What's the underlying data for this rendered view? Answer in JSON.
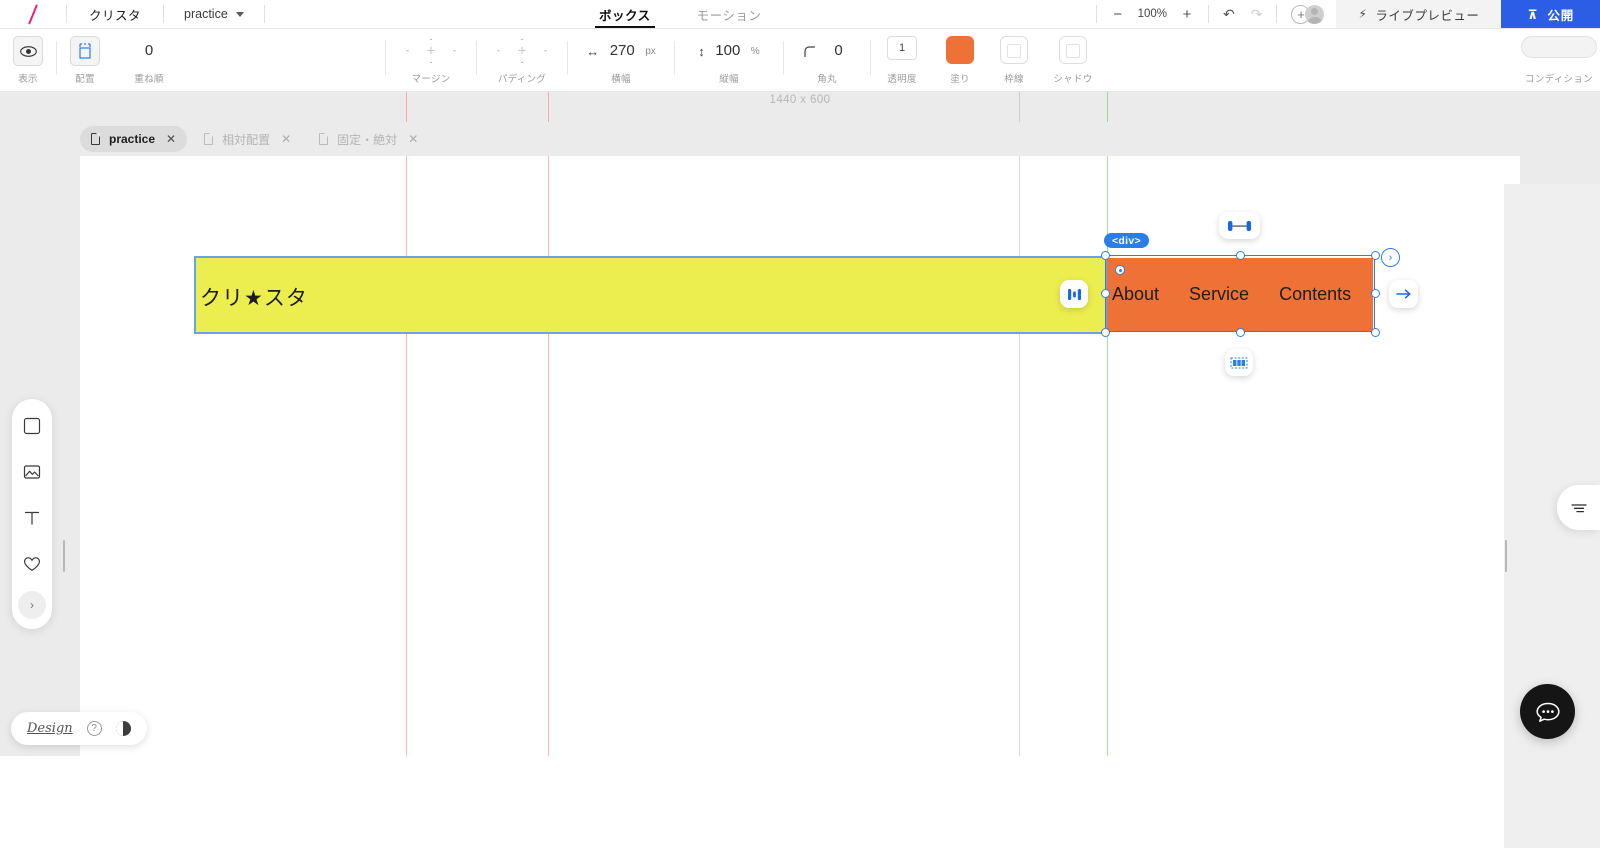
{
  "topbar": {
    "logo": "slash-logo",
    "brand": "クリスタ",
    "project": "practice",
    "tabs": [
      {
        "label": "ボックス",
        "active": true
      },
      {
        "label": "モーション",
        "active": false
      }
    ],
    "zoom": {
      "out": "−",
      "level": "100%",
      "in": "+"
    },
    "undo": "↶",
    "redo": "↷",
    "add": "+",
    "live_preview": "ライブプレビュー",
    "publish": "公開",
    "publish_color": "#2c5de5"
  },
  "properties": {
    "visibility": {
      "label": "表示",
      "icon": "eye-icon"
    },
    "layout": {
      "label": "配置",
      "icon": "layout-icon"
    },
    "zorder": {
      "label": "重ね順",
      "value": "0"
    },
    "margin": {
      "label": "マージン",
      "top": "-",
      "right": "-",
      "bottom": "-",
      "left": "-",
      "center": "+"
    },
    "padding": {
      "label": "パディング",
      "top": "-",
      "right": "-",
      "bottom": "-",
      "left": "-",
      "center": "+"
    },
    "width": {
      "label": "横幅",
      "value": "270",
      "unit": "px",
      "icon": "↔"
    },
    "height": {
      "label": "縦幅",
      "value": "100",
      "unit": "%",
      "icon": "↕"
    },
    "radius": {
      "label": "角丸",
      "value": "0",
      "icon": "⌐"
    },
    "opacity": {
      "label": "透明度",
      "value": "1"
    },
    "fill": {
      "label": "塗り",
      "color": "#ee7136"
    },
    "border": {
      "label": "枠線",
      "color": ""
    },
    "shadow": {
      "label": "シャドウ",
      "color": ""
    },
    "condition": {
      "label": "コンディション"
    }
  },
  "page_tabs": [
    {
      "label": "practice",
      "active": true,
      "close": "✕"
    },
    {
      "label": "相対配置",
      "active": false,
      "close": "✕"
    },
    {
      "label": "固定・絶対",
      "active": false,
      "close": "✕"
    }
  ],
  "canvas": {
    "size_label": "1440 x 600",
    "yellow_box": {
      "text": "クリ★スタ",
      "color": "#ecee4f"
    },
    "orange_box": {
      "color": "#ee7136",
      "badge": "<div>",
      "links": [
        "About",
        "Service",
        "Contents"
      ]
    },
    "selection_color": "#2b7de9"
  },
  "floating_tools": {
    "halign": "horizontal-align-icon",
    "spacing": "spacing-icon",
    "grid": "grid-columns-icon",
    "arrow": "arrow-right-icon",
    "chevron": "›"
  },
  "left_dock": {
    "tools": [
      {
        "name": "box-tool",
        "icon": "square-icon"
      },
      {
        "name": "image-tool",
        "icon": "image-icon"
      },
      {
        "name": "text-tool",
        "icon": "text-icon"
      },
      {
        "name": "favorite-tool",
        "icon": "heart-icon"
      }
    ],
    "expand": "›"
  },
  "right_panel": {
    "icon": "layers-icon"
  },
  "bottom_bar": {
    "brand": "Design",
    "help": "?",
    "theme": "theme-toggle-icon"
  },
  "chat": {
    "icon": "chat-bubble-icon"
  }
}
